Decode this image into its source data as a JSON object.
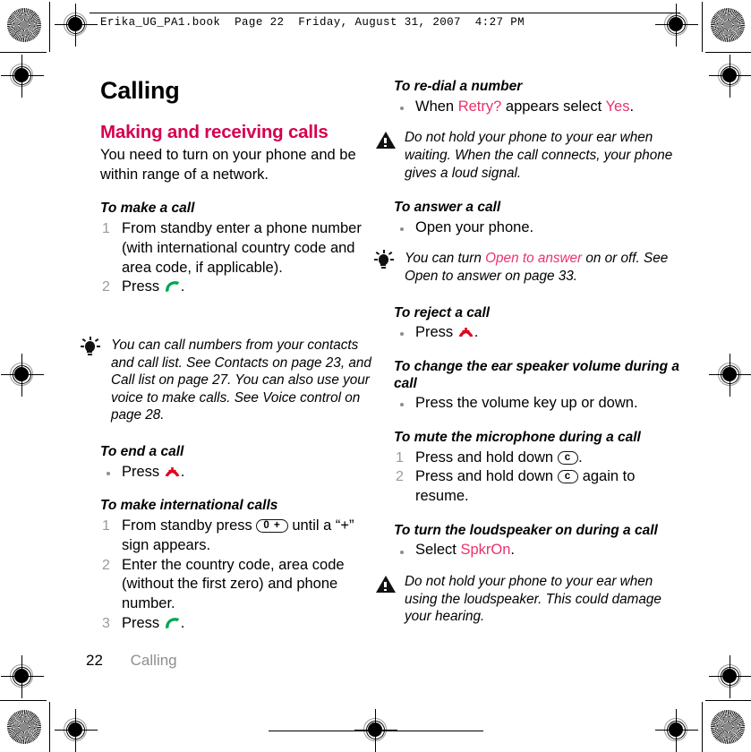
{
  "file_header": "Erika_UG_PA1.book  Page 22  Friday, August 31, 2007  4:27 PM",
  "chapter_title": "Calling",
  "left_column": {
    "section_heading": "Making and receiving calls",
    "intro": "You need to turn on your phone and be within range of a network.",
    "task_make_call": {
      "title": "To make a call",
      "step1": "From standby enter a phone number (with international country code and area code, if applicable).",
      "step2_prefix": "Press",
      "step2_suffix": "."
    },
    "tip_contacts": "You can call numbers from your contacts and call list. See Contacts on page 23, and Call list on page 27. You can also use your voice to make calls. See Voice control on page 28.",
    "task_end_call": {
      "title": "To end a call",
      "bullet_prefix": "Press",
      "bullet_suffix": "."
    },
    "task_international": {
      "title": "To make international calls",
      "step1_a": "From standby press",
      "step1_key": "0 +",
      "step1_b": "until a “+” sign appears.",
      "step2": "Enter the country code, area code (without the first zero) and phone number.",
      "step3_prefix": "Press",
      "step3_suffix": "."
    }
  },
  "right_column": {
    "task_redial": {
      "title": "To re-dial a number",
      "bullet_a": "When",
      "bullet_hl1": "Retry?",
      "bullet_b": "appears select",
      "bullet_hl2": "Yes",
      "bullet_c": "."
    },
    "warning_waiting": "Do not hold your phone to your ear when waiting. When the call connects, your phone gives a loud signal.",
    "task_answer": {
      "title": "To answer a call",
      "bullet": "Open your phone."
    },
    "tip_open_answer": {
      "a": "You can turn",
      "hl": "Open to answer",
      "b": "on or off. See Open to answer on page 33."
    },
    "task_reject": {
      "title": "To reject a call",
      "bullet_prefix": "Press",
      "bullet_suffix": "."
    },
    "task_volume": {
      "title": "To change the ear speaker volume during a call",
      "bullet": "Press the volume key up or down."
    },
    "task_mute": {
      "title": "To mute the microphone during a call",
      "step1_a": "Press and hold down",
      "step1_key": "c",
      "step1_b": ".",
      "step2_a": "Press and hold down",
      "step2_key": "c",
      "step2_b": "again to resume."
    },
    "task_loudspeaker": {
      "title": "To turn the loudspeaker on during a call",
      "bullet_a": "Select",
      "bullet_hl": "SpkrOn",
      "bullet_b": "."
    },
    "warning_loudspeaker": "Do not hold your phone to your ear when using the loudspeaker. This could damage your hearing."
  },
  "footer": {
    "page_number": "22",
    "section_name": "Calling"
  },
  "colors": {
    "accent_heading": "#D6004F",
    "accent_inline": "#E8336B",
    "call_green": "#00A650",
    "end_call_red": "#E2001A",
    "footer_gray": "#8f8f8f"
  },
  "icons": {
    "warning": "warning-triangle-icon",
    "tip": "lightbulb-tip-icon",
    "call": "green-call-handset-icon",
    "end_call": "red-end-call-handset-icon",
    "star_target": "print-star-target-mark",
    "registration": "print-registration-crosshair-mark"
  }
}
